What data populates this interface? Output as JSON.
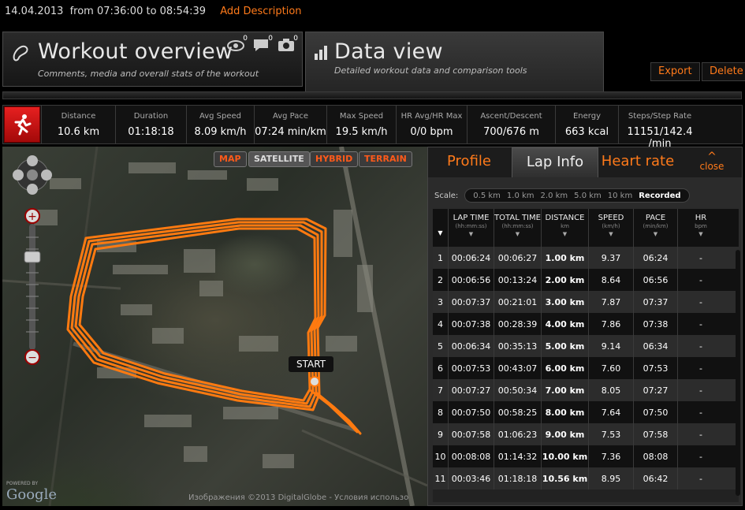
{
  "header": {
    "date": "14.04.2013",
    "time_range": "from 07:36:00 to 08:54:39",
    "add_description": "Add Description"
  },
  "tabs": {
    "overview": {
      "title": "Workout overview",
      "subtitle": "Comments, media and overall stats of the workout",
      "counts": {
        "views": "0",
        "comments": "0",
        "photos": "0"
      }
    },
    "data_view": {
      "title": "Data view",
      "subtitle": "Detailed workout data and comparison tools"
    }
  },
  "actions": {
    "export": "Export",
    "delete": "Delete"
  },
  "stats": [
    {
      "label": "Distance",
      "value": "10.6 km"
    },
    {
      "label": "Duration",
      "value": "01:18:18"
    },
    {
      "label": "Avg Speed",
      "value": "8.09 km/h"
    },
    {
      "label": "Avg Pace",
      "value": "07:24 min/km"
    },
    {
      "label": "Max Speed",
      "value": "19.5 km/h"
    },
    {
      "label": "HR Avg/HR Max",
      "value": "0/0 bpm"
    },
    {
      "label": "Ascent/Descent",
      "value": "700/676 m"
    },
    {
      "label": "Energy",
      "value": "663 kcal"
    },
    {
      "label": "Steps/Step Rate",
      "value": "11151/142.4 /min"
    }
  ],
  "map": {
    "types": [
      "MAP",
      "SATELLITE",
      "HYBRID",
      "TERRAIN"
    ],
    "selected_type": "SATELLITE",
    "start_label": "START",
    "powered_by": "POWERED BY",
    "google": "Google",
    "copyright": "Изображения ©2013 DigitalGlobe - Условия использо"
  },
  "panel": {
    "tabs": [
      "Profile",
      "Lap Info",
      "Heart rate"
    ],
    "active_tab": "Lap Info",
    "close": "close",
    "scale_label": "Scale:",
    "scale_options": [
      "0.5 km",
      "1.0 km",
      "2.0 km",
      "5.0 km",
      "10 km",
      "Recorded"
    ],
    "scale_selected": "Recorded"
  },
  "lap_table": {
    "columns": [
      {
        "title": "LAP TIME",
        "unit": "(hh:mm:ss)"
      },
      {
        "title": "TOTAL TIME",
        "unit": "(hh:mm:ss)"
      },
      {
        "title": "DISTANCE",
        "unit": "km"
      },
      {
        "title": "SPEED",
        "unit": "(km/h)"
      },
      {
        "title": "PACE",
        "unit": "(min/km)"
      },
      {
        "title": "HR",
        "unit": "bpm"
      }
    ],
    "rows": [
      [
        "1",
        "00:06:24",
        "00:06:27",
        "1.00 km",
        "9.37",
        "06:24",
        "-"
      ],
      [
        "2",
        "00:06:56",
        "00:13:24",
        "2.00 km",
        "8.64",
        "06:56",
        "-"
      ],
      [
        "3",
        "00:07:37",
        "00:21:01",
        "3.00 km",
        "7.87",
        "07:37",
        "-"
      ],
      [
        "4",
        "00:07:38",
        "00:28:39",
        "4.00 km",
        "7.86",
        "07:38",
        "-"
      ],
      [
        "5",
        "00:06:34",
        "00:35:13",
        "5.00 km",
        "9.14",
        "06:34",
        "-"
      ],
      [
        "6",
        "00:07:53",
        "00:43:07",
        "6.00 km",
        "7.60",
        "07:53",
        "-"
      ],
      [
        "7",
        "00:07:27",
        "00:50:34",
        "7.00 km",
        "8.05",
        "07:27",
        "-"
      ],
      [
        "8",
        "00:07:50",
        "00:58:25",
        "8.00 km",
        "7.64",
        "07:50",
        "-"
      ],
      [
        "9",
        "00:07:58",
        "01:06:23",
        "9.00 km",
        "7.53",
        "07:58",
        "-"
      ],
      [
        "10",
        "00:08:08",
        "01:14:32",
        "10.00 km",
        "7.36",
        "08:08",
        "-"
      ],
      [
        "11",
        "00:03:46",
        "01:18:18",
        "10.56 km",
        "8.95",
        "06:42",
        "-"
      ]
    ]
  },
  "colors": {
    "accent": "#ff7a1a",
    "route": "#ff7a10",
    "runner_badge": "#d81414"
  }
}
